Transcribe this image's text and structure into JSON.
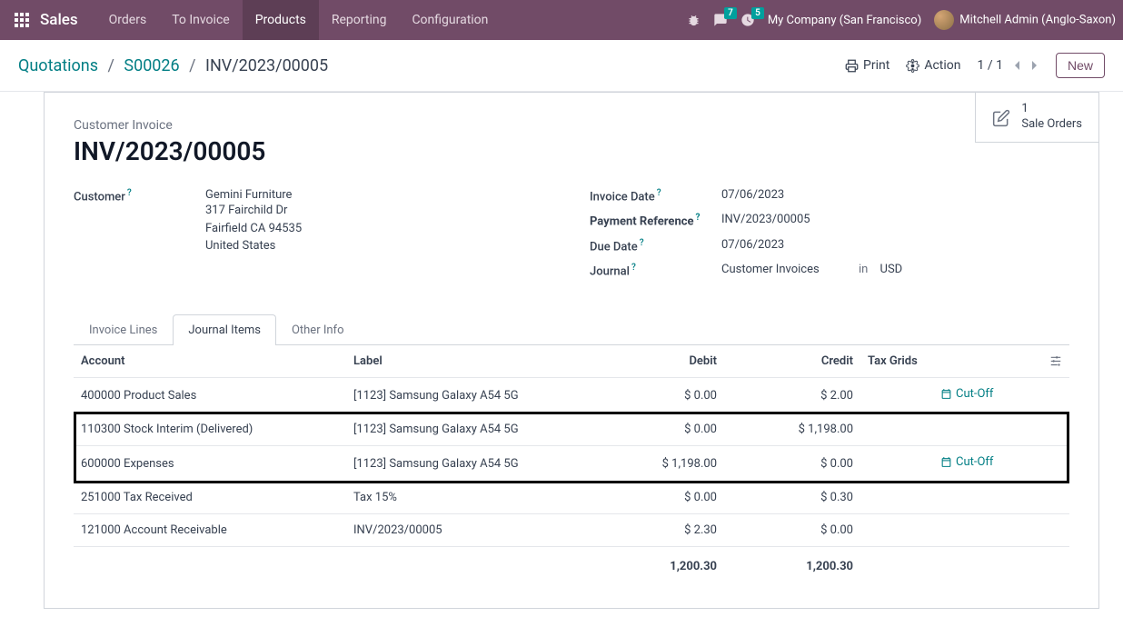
{
  "nav": {
    "brand": "Sales",
    "items": [
      "Orders",
      "To Invoice",
      "Products",
      "Reporting",
      "Configuration"
    ],
    "active": "Products",
    "messages_badge": "7",
    "activities_badge": "5",
    "company": "My Company (San Francisco)",
    "user": "Mitchell Admin (Anglo-Saxon)"
  },
  "breadcrumb": {
    "root": "Quotations",
    "order": "S00026",
    "current": "INV/2023/00005"
  },
  "controls": {
    "print": "Print",
    "action": "Action",
    "pager": "1 / 1",
    "new": "New"
  },
  "stat": {
    "count": "1",
    "label": "Sale Orders"
  },
  "doc": {
    "type": "Customer Invoice",
    "title": "INV/2023/00005"
  },
  "left_fields": {
    "customer_label": "Customer",
    "customer_name": "Gemini Furniture",
    "addr1": "317 Fairchild Dr",
    "addr2": "Fairfield CA 94535",
    "addr3": "United States"
  },
  "right_fields": {
    "invoice_date_label": "Invoice Date",
    "invoice_date": "07/06/2023",
    "payment_ref_label": "Payment Reference",
    "payment_ref": "INV/2023/00005",
    "due_date_label": "Due Date",
    "due_date": "07/06/2023",
    "journal_label": "Journal",
    "journal": "Customer Invoices",
    "in_label": "in",
    "currency": "USD"
  },
  "tabs": [
    "Invoice Lines",
    "Journal Items",
    "Other Info"
  ],
  "active_tab": "Journal Items",
  "table": {
    "headers": {
      "account": "Account",
      "label": "Label",
      "debit": "Debit",
      "credit": "Credit",
      "tax_grids": "Tax Grids"
    },
    "rows": [
      {
        "account": "400000 Product Sales",
        "label": "[1123] Samsung Galaxy A54 5G",
        "debit": "$ 0.00",
        "credit": "$ 2.00",
        "tax_grids": "",
        "cutoff": true
      },
      {
        "account": "110300 Stock Interim (Delivered)",
        "label": "[1123] Samsung Galaxy A54 5G",
        "debit": "$ 0.00",
        "credit": "$ 1,198.00",
        "tax_grids": "",
        "cutoff": false,
        "highlight": true
      },
      {
        "account": "600000 Expenses",
        "label": "[1123] Samsung Galaxy A54 5G",
        "debit": "$ 1,198.00",
        "credit": "$ 0.00",
        "tax_grids": "",
        "cutoff": true,
        "highlight": true
      },
      {
        "account": "251000 Tax Received",
        "label": "Tax 15%",
        "debit": "$ 0.00",
        "credit": "$ 0.30",
        "tax_grids": "",
        "cutoff": false
      },
      {
        "account": "121000 Account Receivable",
        "label": "INV/2023/00005",
        "debit": "$ 2.30",
        "credit": "$ 0.00",
        "tax_grids": "",
        "cutoff": false
      }
    ],
    "totals": {
      "debit": "1,200.30",
      "credit": "1,200.30"
    },
    "cutoff_label": "Cut-Off"
  }
}
